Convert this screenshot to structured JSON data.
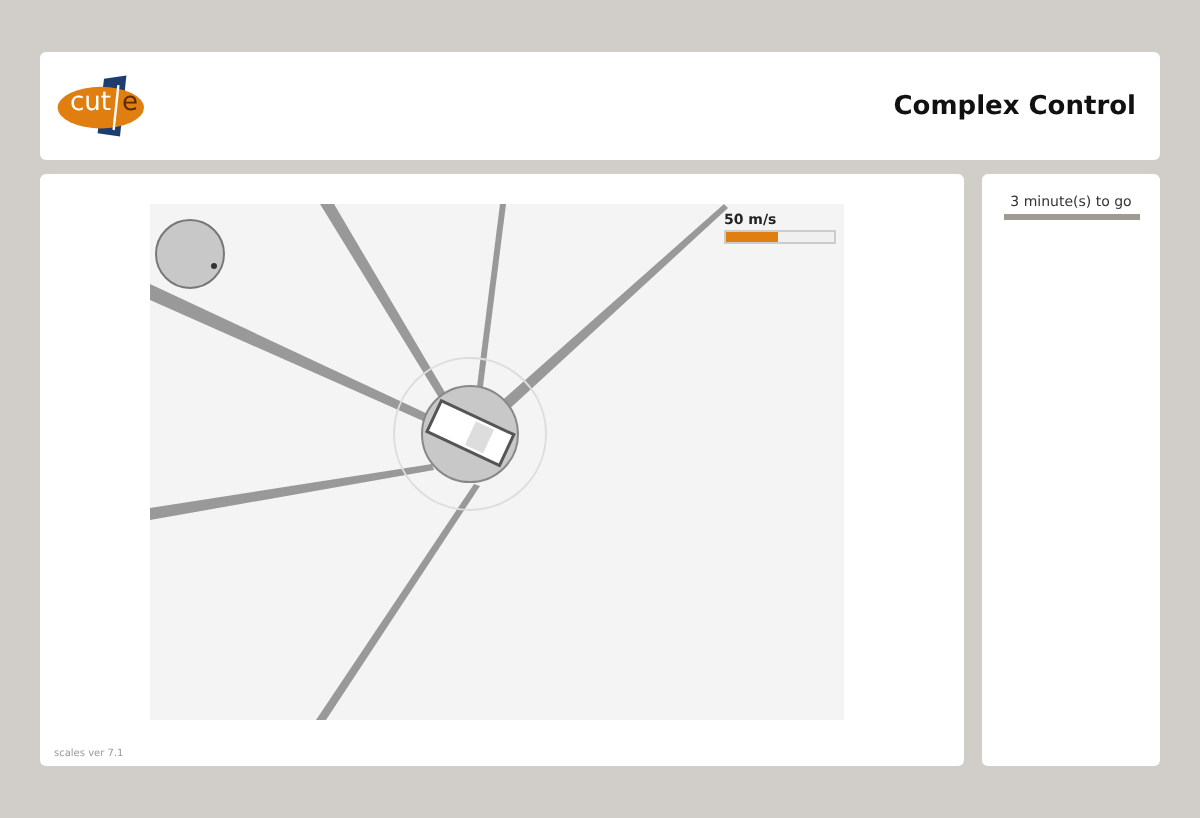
{
  "header": {
    "logo": {
      "left": "cut",
      "right": "e"
    },
    "title": "Complex Control"
  },
  "game": {
    "speed": {
      "label": "50 m/s",
      "level": 0.48
    }
  },
  "timer": {
    "label": "3 minute(s) to go",
    "level": 1
  },
  "footer": {
    "version": "scales ver 7.1"
  }
}
